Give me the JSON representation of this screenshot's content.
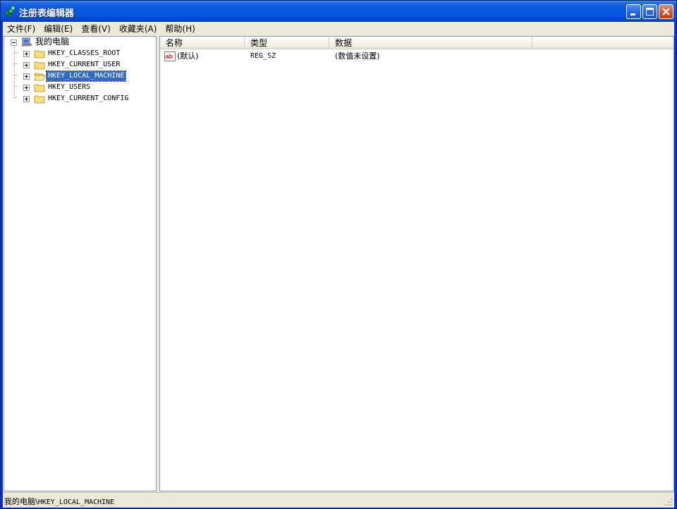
{
  "window": {
    "title": "注册表编辑器",
    "icon": "regedit-icon"
  },
  "menu": {
    "items": [
      {
        "label": "文件(F)"
      },
      {
        "label": "编辑(E)"
      },
      {
        "label": "查看(V)"
      },
      {
        "label": "收藏夹(A)"
      },
      {
        "label": "帮助(H)"
      }
    ]
  },
  "tree": {
    "root": {
      "label": "我的电脑",
      "icon": "computer-icon",
      "expanded": true
    },
    "children": [
      {
        "label": "HKEY_CLASSES_ROOT",
        "icon": "folder-icon",
        "selected": false
      },
      {
        "label": "HKEY_CURRENT_USER",
        "icon": "folder-icon",
        "selected": false
      },
      {
        "label": "HKEY_LOCAL_MACHINE",
        "icon": "folder-open-icon",
        "selected": true
      },
      {
        "label": "HKEY_USERS",
        "icon": "folder-icon",
        "selected": false
      },
      {
        "label": "HKEY_CURRENT_CONFIG",
        "icon": "folder-icon",
        "selected": false
      }
    ]
  },
  "list": {
    "columns": [
      "名称",
      "类型",
      "数据"
    ],
    "rows": [
      {
        "name": "(默认)",
        "type": "REG_SZ",
        "data": "(数值未设置)",
        "icon": "string-value-icon"
      }
    ]
  },
  "status": {
    "path_prefix": "我的电脑\\",
    "path_key": "HKEY_LOCAL_MACHINE"
  },
  "colors": {
    "titlebar": "#0754dd",
    "selection": "#316ac5",
    "chrome": "#ece9d8"
  }
}
